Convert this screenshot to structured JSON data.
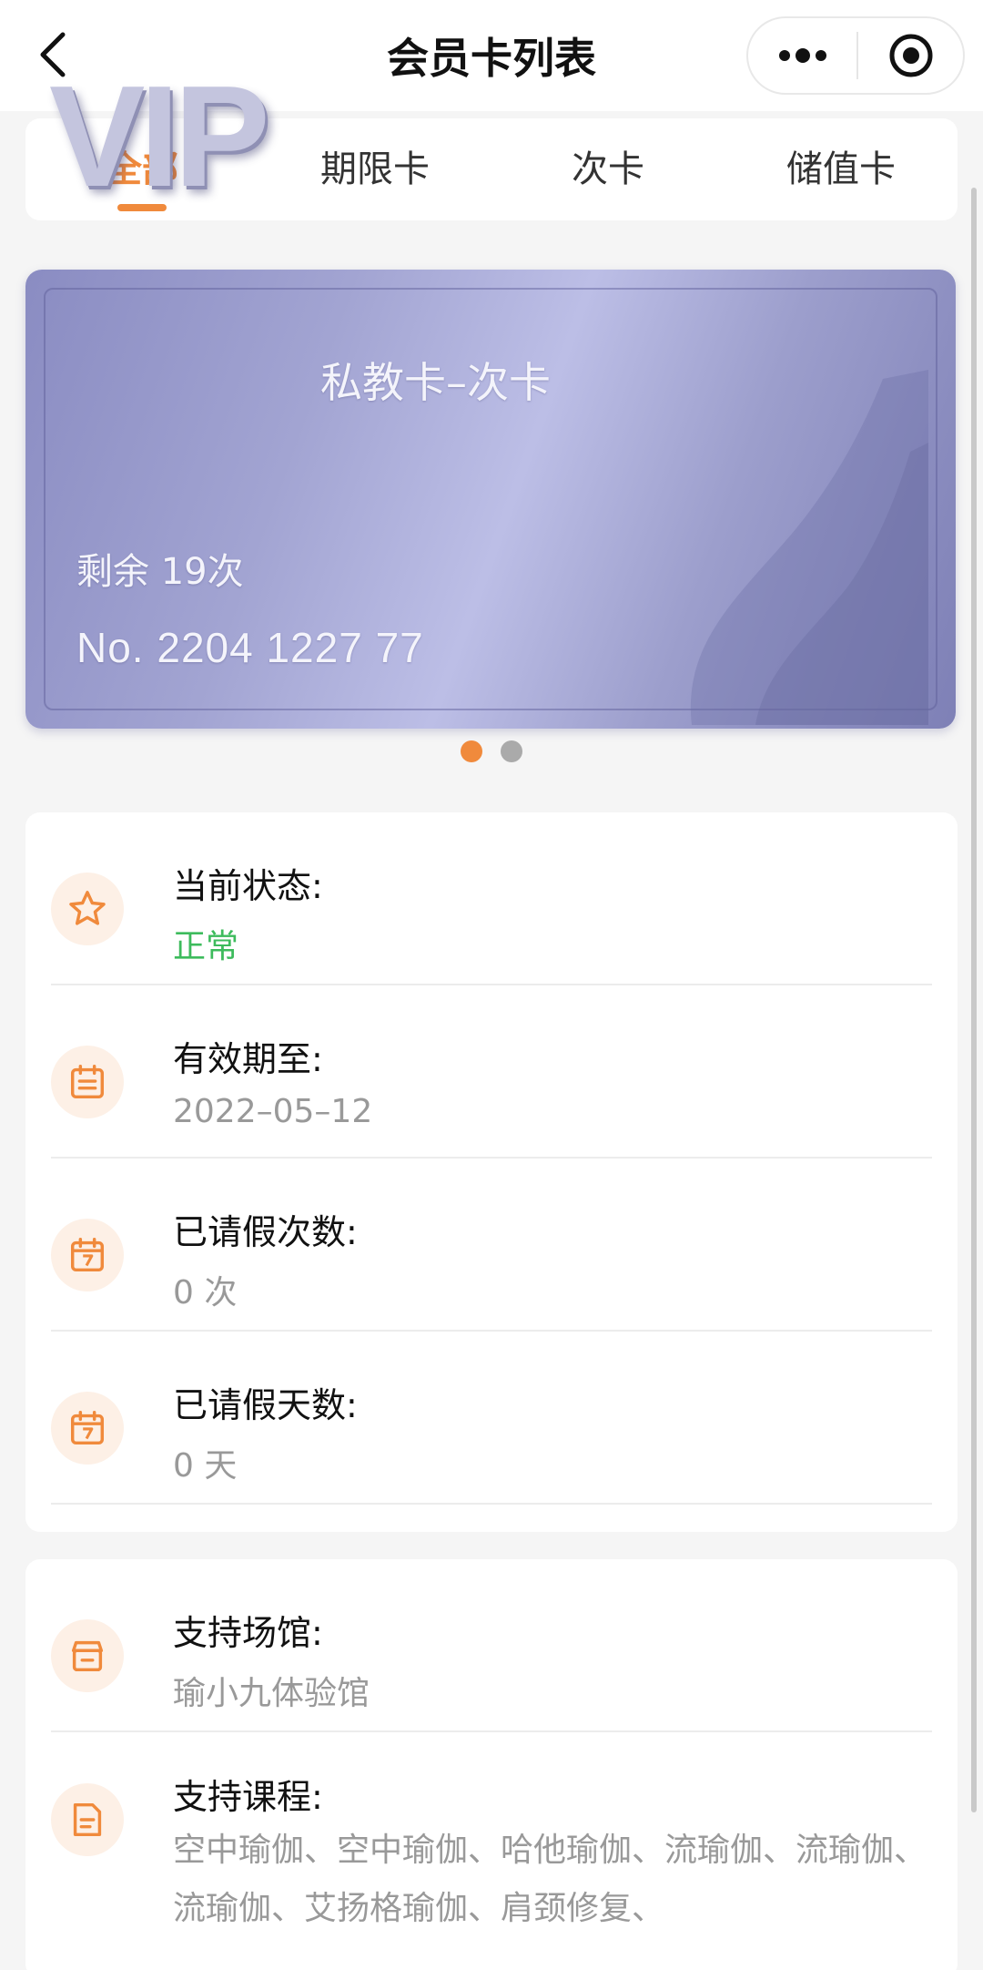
{
  "nav": {
    "title": "会员卡列表",
    "back_icon": "chevron-left-icon",
    "more_icon": "more-dots-icon",
    "target_icon": "record-target-icon"
  },
  "tabs": [
    {
      "label": "全部",
      "active": true
    },
    {
      "label": "期限卡",
      "active": false
    },
    {
      "label": "次卡",
      "active": false
    },
    {
      "label": "储值卡",
      "active": false
    }
  ],
  "card": {
    "logo_text": "VIP",
    "name": "私教卡–次卡",
    "remaining": "剩余 19次",
    "number": "No.  2204 1227 77",
    "carousel_total": 2,
    "carousel_active": 1
  },
  "info": {
    "status_label": "当前状态:",
    "status_value": "正常",
    "expiry_label": "有效期至:",
    "expiry_value": "2022–05–12",
    "leave_count_label": "已请假次数:",
    "leave_count_value": "0 次",
    "leave_days_label": "已请假天数:",
    "leave_days_value": "0 天"
  },
  "support": {
    "venue_label": "支持场馆:",
    "venue_value": "瑜小九体验馆",
    "course_label": "支持课程:",
    "course_value": "空中瑜伽、空中瑜伽、哈他瑜伽、流瑜伽、流瑜伽、流瑜伽、艾扬格瑜伽、肩颈修复、"
  },
  "colors": {
    "accent": "#f08a3c",
    "status_ok": "#3dbb5c",
    "card_gradient_mid": "#bcbee6",
    "icon_bg": "#fdf0e6"
  }
}
